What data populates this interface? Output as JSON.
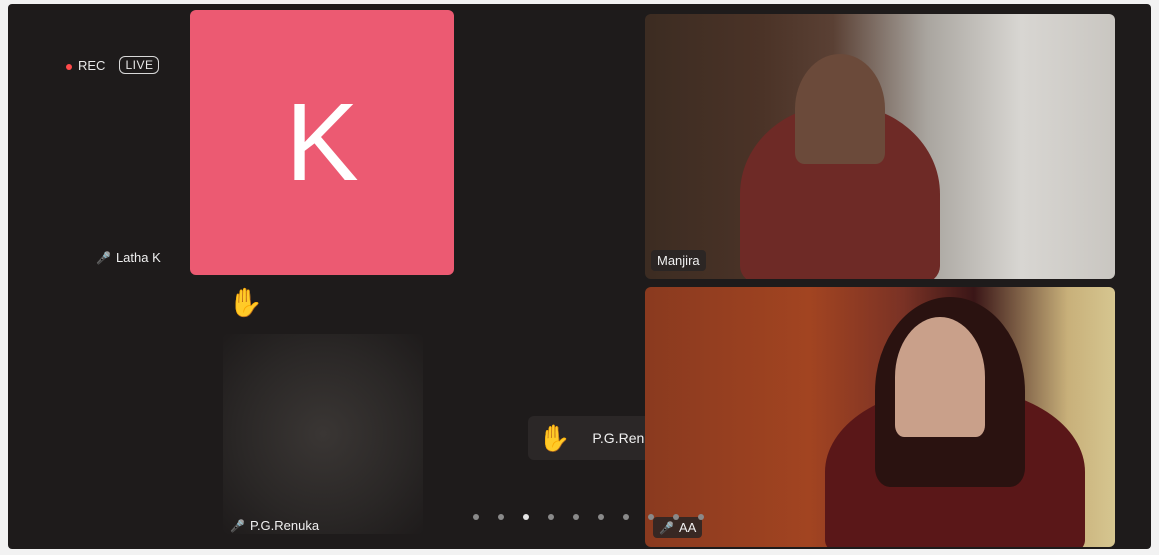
{
  "status": {
    "rec_label": "REC",
    "live_label": "LIVE"
  },
  "participants": {
    "latha": {
      "initial": "K",
      "name": "Latha K"
    },
    "manjira": {
      "name": "Manjira"
    },
    "renuka_tile": {
      "name": "P.G.Renuka"
    },
    "renuka_pill": {
      "name": "P.G.Renuka",
      "hand_raised": "raised-hand-icon"
    },
    "aa": {
      "name": "AA"
    }
  },
  "pagination": {
    "total_dots": 10,
    "active_index": 2
  },
  "colors": {
    "avatar_bg": "#ec5a72",
    "rec_dot": "#ff4a4a"
  }
}
